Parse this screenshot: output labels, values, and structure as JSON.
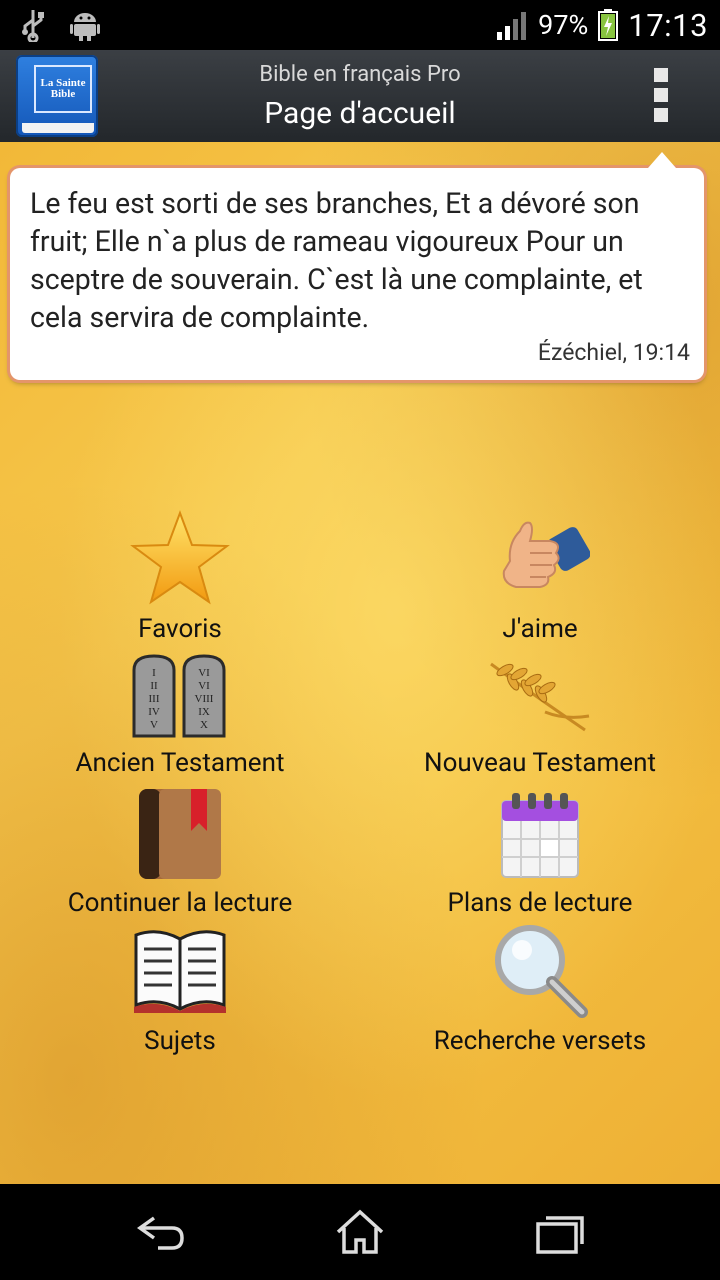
{
  "status_bar": {
    "battery_percent": "97%",
    "time": "17:13",
    "left_icons": [
      "usb-icon",
      "android-icon"
    ]
  },
  "action_bar": {
    "app_icon_text": "La Sainte Bible",
    "subtitle": "Bible en français Pro",
    "title": "Page d'accueil"
  },
  "verse": {
    "text": "Le feu est sorti de ses branches, Et a dévoré son fruit; Elle n`a plus de rameau vigoureux Pour un sceptre de souverain. C`est là une complainte, et cela servira de complainte.",
    "reference": "Ézéchiel, 19:14"
  },
  "menu": [
    {
      "label": "Favoris",
      "icon": "star-icon"
    },
    {
      "label": "J'aime",
      "icon": "thumbs-up-icon"
    },
    {
      "label": "Ancien Testament",
      "icon": "stone-tablets-icon"
    },
    {
      "label": "Nouveau Testament",
      "icon": "wheat-icon"
    },
    {
      "label": "Continuer la lecture",
      "icon": "bookmarked-book-icon"
    },
    {
      "label": "Plans de lecture",
      "icon": "calendar-icon"
    },
    {
      "label": "Sujets",
      "icon": "open-book-icon"
    },
    {
      "label": "Recherche versets",
      "icon": "magnifier-icon"
    }
  ],
  "tablets": {
    "left": [
      "I",
      "II",
      "III",
      "IV",
      "V"
    ],
    "right": [
      "VI",
      "VI",
      "VIII",
      "IX",
      "X"
    ]
  },
  "nav_bar": [
    "back-icon",
    "home-icon",
    "recent-apps-icon"
  ],
  "colors": {
    "parchment": "#f4c142",
    "action_bar": "#2d3135",
    "card_border": "#e4956a"
  }
}
